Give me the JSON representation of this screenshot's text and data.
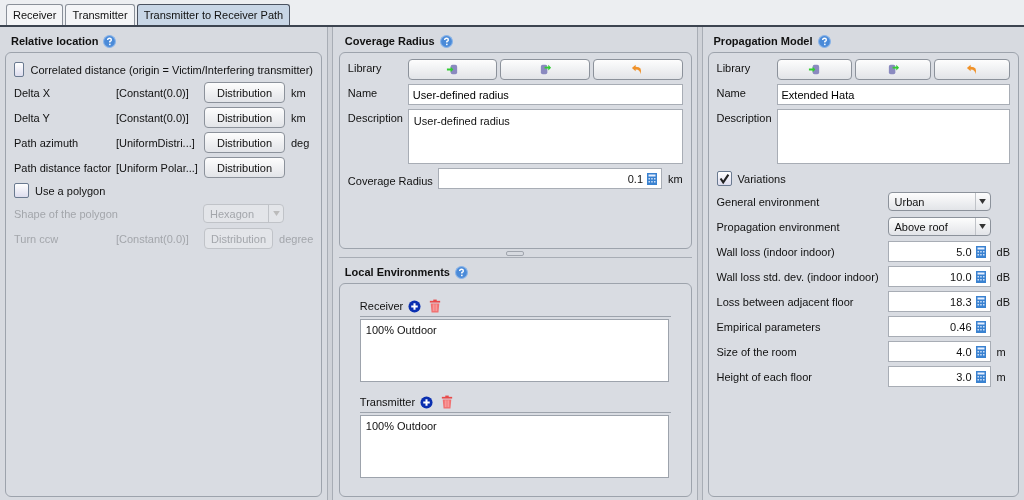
{
  "tabs": [
    {
      "label": "Receiver",
      "selected": false
    },
    {
      "label": "Transmitter",
      "selected": false
    },
    {
      "label": "Transmitter to Receiver Path",
      "selected": true
    }
  ],
  "relative_location": {
    "title": "Relative location",
    "items": [
      {
        "kind": "checkbox",
        "label": "Correlated distance (origin = Victim/Interfering transmitter)",
        "checked": false
      },
      {
        "kind": "distribution",
        "label": "Delta X",
        "value": "[Constant(0.0)]",
        "button": "Distribution",
        "unit": "km",
        "disabled": false
      },
      {
        "kind": "distribution",
        "label": "Delta Y",
        "value": "[Constant(0.0)]",
        "button": "Distribution",
        "unit": "km",
        "disabled": false
      },
      {
        "kind": "distribution",
        "label": "Path azimuth",
        "value": "[UniformDistri...]",
        "button": "Distribution",
        "unit": "deg",
        "disabled": false
      },
      {
        "kind": "distribution",
        "label": "Path distance factor",
        "value": "[Uniform Polar...]",
        "button": "Distribution",
        "disabled": false
      },
      {
        "kind": "checkbox",
        "label": "Use a polygon",
        "checked": false
      },
      {
        "kind": "select",
        "label": "Shape of the polygon",
        "value": "Hexagon",
        "disabled": true
      },
      {
        "kind": "distribution",
        "label": "Turn ccw",
        "value": "[Constant(0.0)]",
        "button": "Distribution",
        "unit": "degree",
        "disabled": true
      }
    ]
  },
  "coverage_radius": {
    "title": "Coverage Radius",
    "library_label": "Library",
    "name_label": "Name",
    "name": "User-defined radius",
    "description_label": "Description",
    "description": "User-defined radius",
    "field_label": "Coverage Radius",
    "value": "0.1",
    "unit": "km"
  },
  "local_environments": {
    "title": "Local Environments",
    "lists": [
      {
        "label": "Receiver",
        "items": [
          "100% Outdoor"
        ]
      },
      {
        "label": "Transmitter",
        "items": [
          "100% Outdoor"
        ]
      }
    ]
  },
  "propagation_model": {
    "title": "Propagation Model",
    "library_label": "Library",
    "name_label": "Name",
    "name": "Extended Hata",
    "description_label": "Description",
    "variations": {
      "label": "Variations",
      "checked": true
    },
    "params": [
      {
        "kind": "select",
        "label": "General environment",
        "value": "Urban"
      },
      {
        "kind": "select",
        "label": "Propagation environment",
        "value": "Above roof"
      },
      {
        "kind": "number",
        "label": "Wall loss (indoor indoor)",
        "value": "5.0",
        "unit": "dB"
      },
      {
        "kind": "number",
        "label": "Wall loss std. dev. (indoor indoor)",
        "value": "10.0",
        "unit": "dB"
      },
      {
        "kind": "number",
        "label": "Loss between adjacent floor",
        "value": "18.3",
        "unit": "dB"
      },
      {
        "kind": "number",
        "label": "Empirical parameters",
        "value": "0.46"
      },
      {
        "kind": "number",
        "label": "Size of the room",
        "value": "4.0",
        "unit": "m"
      },
      {
        "kind": "number",
        "label": "Height of each floor",
        "value": "3.0",
        "unit": "m"
      }
    ]
  }
}
